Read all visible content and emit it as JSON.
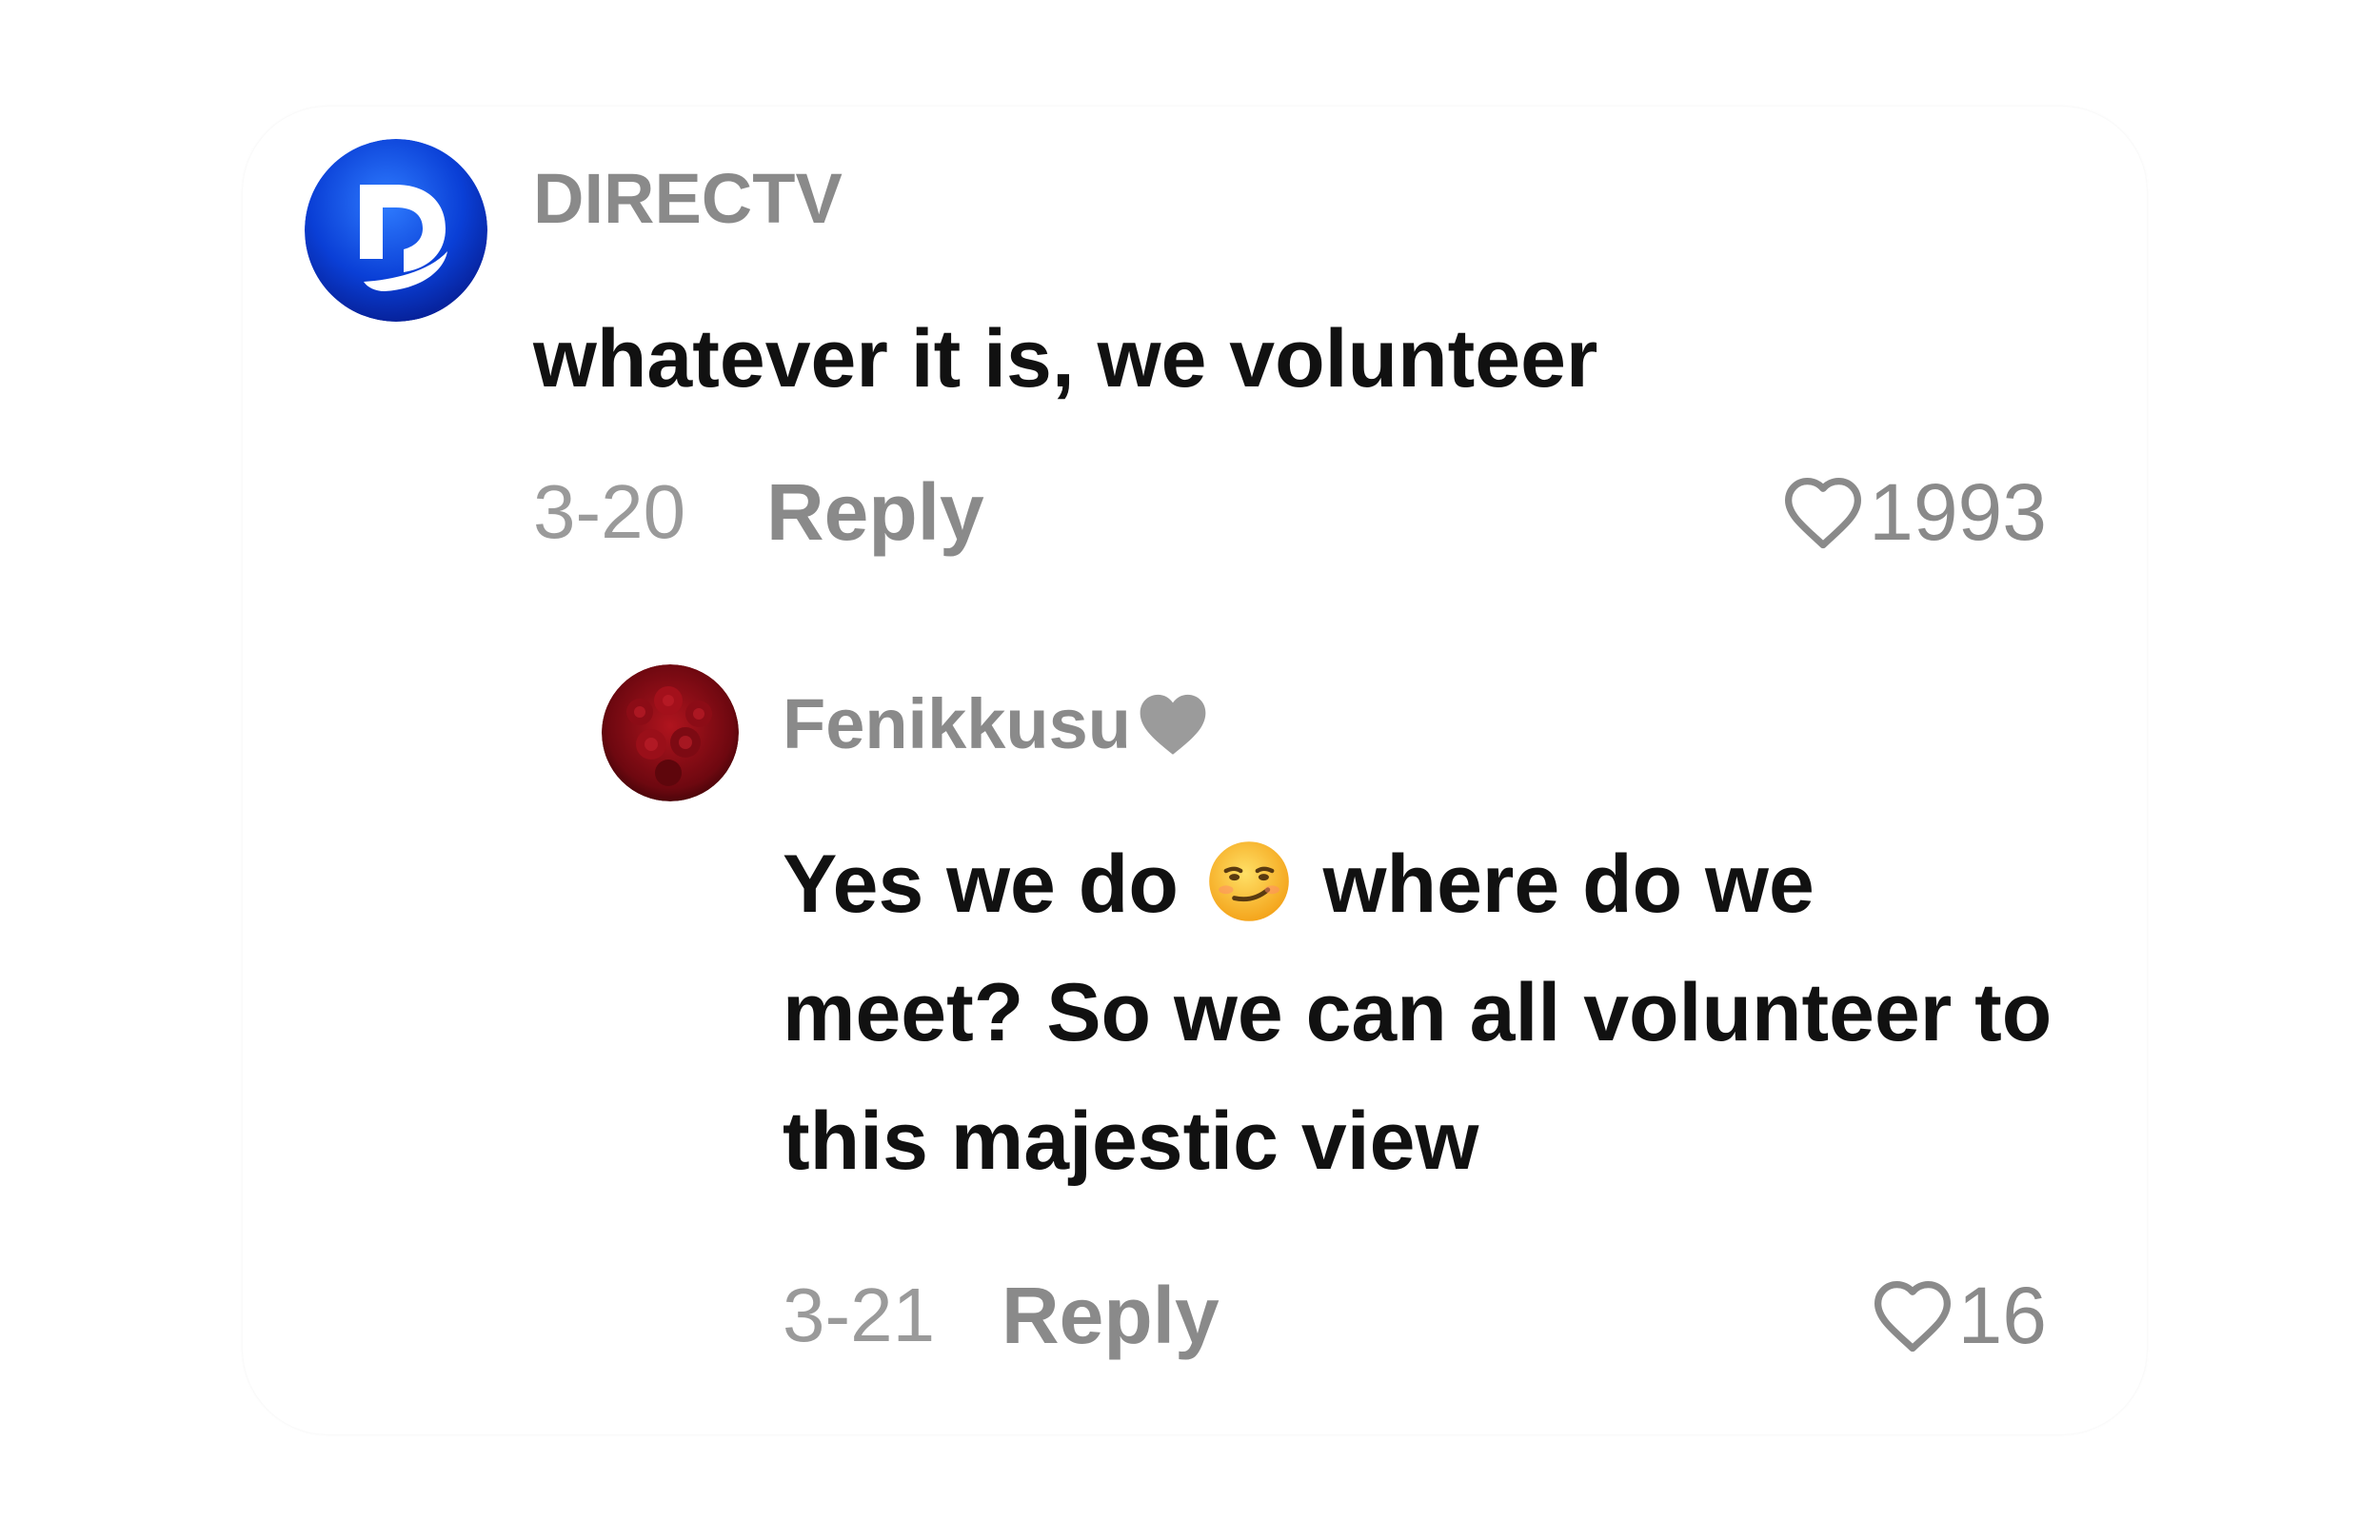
{
  "comment": {
    "username": "DIRECTV",
    "text": "whatever it is, we volunteer",
    "date": "3-20",
    "reply_label": "Reply",
    "like_count": "1993",
    "avatar_icon": "directv-logo",
    "avatar_color": "#0a3fd6"
  },
  "reply": {
    "username": "Fenikkusu",
    "username_badge_icon": "grey-heart-icon",
    "text_before_emoji": "Yes we do ",
    "emoji_icon": "smirking-face-emoji",
    "text_after_emoji": " where do we meet? So we can all volunteer to this majestic view",
    "date": "3-21",
    "reply_label": "Reply",
    "like_count": "16",
    "avatar_icon": "red-roses-avatar",
    "avatar_color": "#7a0a12"
  }
}
